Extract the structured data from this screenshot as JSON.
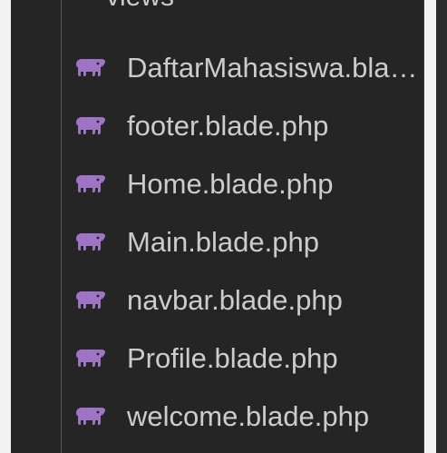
{
  "explorer": {
    "folder": {
      "label": "views",
      "icon": "chevron-down-icon"
    },
    "files": [
      {
        "label": "DaftarMahasiswa.blade.php",
        "icon": "php-elephant-icon"
      },
      {
        "label": "footer.blade.php",
        "icon": "php-elephant-icon"
      },
      {
        "label": "Home.blade.php",
        "icon": "php-elephant-icon"
      },
      {
        "label": "Main.blade.php",
        "icon": "php-elephant-icon"
      },
      {
        "label": "navbar.blade.php",
        "icon": "php-elephant-icon"
      },
      {
        "label": "Profile.blade.php",
        "icon": "php-elephant-icon"
      },
      {
        "label": "welcome.blade.php",
        "icon": "php-elephant-icon"
      }
    ]
  },
  "colors": {
    "panel_bg": "#252526",
    "text": "#cccccc",
    "icon": "#a074c4",
    "indent_guide": "#585858"
  }
}
